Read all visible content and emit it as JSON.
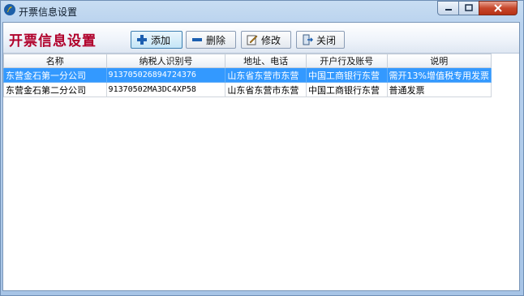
{
  "window": {
    "title": "开票信息设置"
  },
  "toolbar": {
    "page_title": "开票信息设置",
    "buttons": [
      {
        "label": "添加",
        "icon": "plus-icon"
      },
      {
        "label": "删除",
        "icon": "minus-icon"
      },
      {
        "label": "修改",
        "icon": "edit-icon"
      },
      {
        "label": "关闭",
        "icon": "exit-icon"
      }
    ]
  },
  "table": {
    "columns": [
      "名称",
      "纳税人识别号",
      "地址、电话",
      "开户行及账号",
      "说明"
    ],
    "rows": [
      [
        "东营金石第一分公司",
        "913705026894724376",
        "山东省东营市东营",
        "中国工商银行东营",
        "需开13%增值税专用发票"
      ],
      [
        "东营金石第二分公司",
        "91370502MA3DC4XP58",
        "山东省东营市东营",
        "中国工商银行东营",
        "普通发票"
      ]
    ],
    "selected_row": 0
  },
  "colors": {
    "selection": "#3399ff",
    "title_red": "#b0002a",
    "close_button": "#c7472c"
  }
}
